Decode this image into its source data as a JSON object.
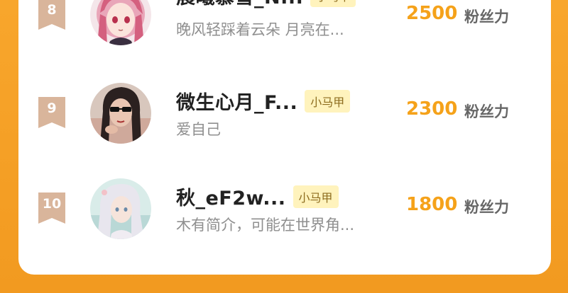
{
  "leaderboard": {
    "fans_unit": "粉丝力",
    "badge_label": "小马甲",
    "colors": {
      "frame": "#f6a42a",
      "card": "#ffffff",
      "rank_badge": "#d9b59b",
      "count": "#f5a21a",
      "badge_bg": "#fff3bd"
    },
    "rows": [
      {
        "rank": "8",
        "name": "晨曦慕雪_N...",
        "bio": "晚风轻踩着云朵 月亮在...",
        "count": "2500",
        "avatar": "anime-girl-pink-hair"
      },
      {
        "rank": "9",
        "name": "微生心月_F...",
        "bio": "爱自己",
        "count": "2300",
        "avatar": "woman-sunglasses"
      },
      {
        "rank": "10",
        "name": "秋_eF2w...",
        "bio": "木有简介，可能在世界角...",
        "count": "1800",
        "avatar": "anime-girl-white-hair"
      }
    ]
  }
}
